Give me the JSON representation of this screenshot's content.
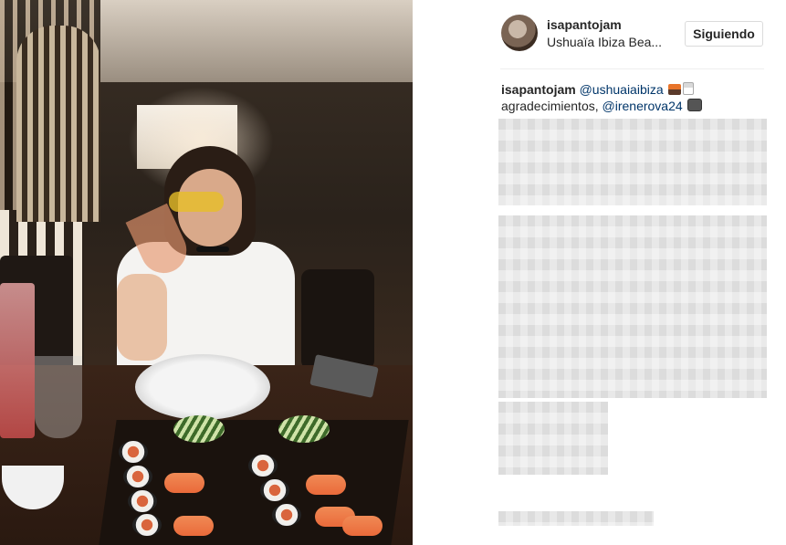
{
  "post": {
    "username": "isapantojam",
    "location": "Ushuaïa Ibiza Bea...",
    "follow_button": "Siguiendo"
  },
  "caption": {
    "username": "isapantojam",
    "mention_1": "@ushuaiaibiza",
    "text": "agradecimientos,",
    "mention_2": "@irenerova24",
    "emoji_1": "sunset-icon",
    "emoji_2": "cocktail-icon",
    "emoji_3": "camera-icon"
  }
}
